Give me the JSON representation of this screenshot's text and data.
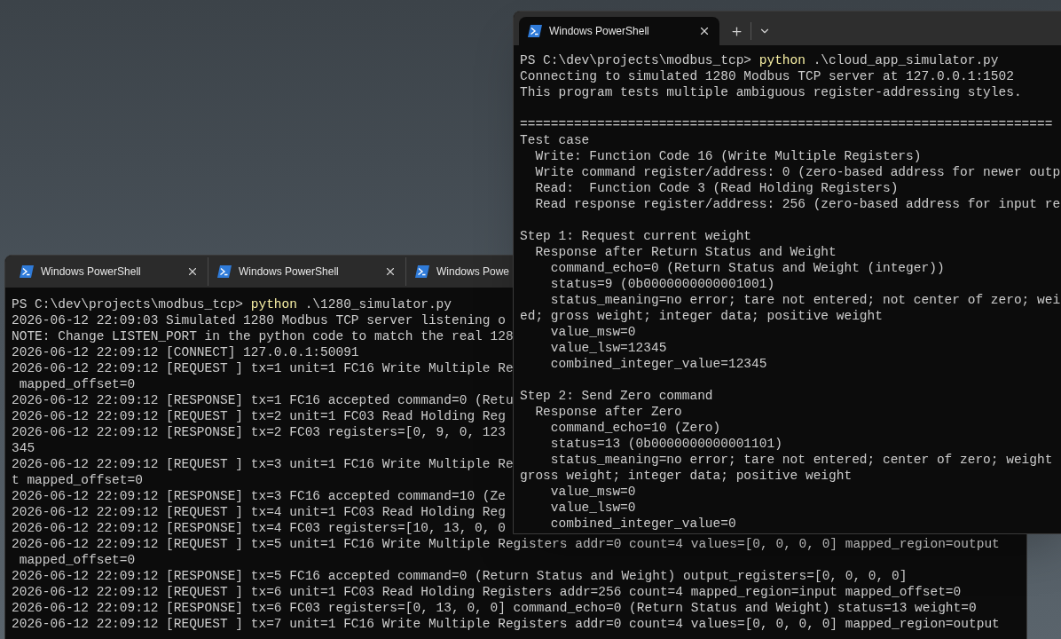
{
  "back_window": {
    "tabs": [
      {
        "title": "Windows PowerShell",
        "selected": false,
        "closable": true
      },
      {
        "title": "Windows PowerShell",
        "selected": false,
        "closable": true
      },
      {
        "title": "Windows Powe",
        "selected": false,
        "closable": false
      }
    ],
    "lines": [
      {
        "kind": "prompt",
        "prompt": "PS C:\\dev\\projects\\modbus_tcp> ",
        "command": "python",
        "args": " .\\1280_simulator.py"
      },
      {
        "kind": "output",
        "text": "2026-06-12 22:09:03 Simulated 1280 Modbus TCP server listening o"
      },
      {
        "kind": "output",
        "text": "NOTE: Change LISTEN_PORT in the python code to match the real 128"
      },
      {
        "kind": "output",
        "text": "2026-06-12 22:09:12 [CONNECT] 127.0.0.1:50091"
      },
      {
        "kind": "output",
        "text": "2026-06-12 22:09:12 [REQUEST ] tx=1 unit=1 FC16 Write Multiple Re"
      },
      {
        "kind": "output",
        "text": " mapped_offset=0"
      },
      {
        "kind": "output",
        "text": "2026-06-12 22:09:12 [RESPONSE] tx=1 FC16 accepted command=0 (Retu"
      },
      {
        "kind": "output",
        "text": "2026-06-12 22:09:12 [REQUEST ] tx=2 unit=1 FC03 Read Holding Reg"
      },
      {
        "kind": "output",
        "text": "2026-06-12 22:09:12 [RESPONSE] tx=2 FC03 registers=[0, 9, 0, 123"
      },
      {
        "kind": "output",
        "text": "345"
      },
      {
        "kind": "output",
        "text": "2026-06-12 22:09:12 [REQUEST ] tx=3 unit=1 FC16 Write Multiple Re"
      },
      {
        "kind": "output",
        "text": "t mapped_offset=0"
      },
      {
        "kind": "output",
        "text": "2026-06-12 22:09:12 [RESPONSE] tx=3 FC16 accepted command=10 (Ze"
      },
      {
        "kind": "output",
        "text": "2026-06-12 22:09:12 [REQUEST ] tx=4 unit=1 FC03 Read Holding Reg"
      },
      {
        "kind": "output",
        "text": "2026-06-12 22:09:12 [RESPONSE] tx=4 FC03 registers=[10, 13, 0, 0"
      },
      {
        "kind": "output",
        "text": "2026-06-12 22:09:12 [REQUEST ] tx=5 unit=1 FC16 Write Multiple Registers addr=0 count=4 values=[0, 0, 0, 0] mapped_region=output"
      },
      {
        "kind": "output",
        "text": " mapped_offset=0"
      },
      {
        "kind": "output",
        "text": "2026-06-12 22:09:12 [RESPONSE] tx=5 FC16 accepted command=0 (Return Status and Weight) output_registers=[0, 0, 0, 0]"
      },
      {
        "kind": "output",
        "text": "2026-06-12 22:09:12 [REQUEST ] tx=6 unit=1 FC03 Read Holding Registers addr=256 count=4 mapped_region=input mapped_offset=0"
      },
      {
        "kind": "output",
        "text": "2026-06-12 22:09:12 [RESPONSE] tx=6 FC03 registers=[0, 13, 0, 0] command_echo=0 (Return Status and Weight) status=13 weight=0"
      },
      {
        "kind": "output",
        "text": "2026-06-12 22:09:12 [REQUEST ] tx=7 unit=1 FC16 Write Multiple Registers addr=0 count=4 values=[0, 0, 0, 0] mapped_region=output"
      }
    ]
  },
  "front_window": {
    "tabs": [
      {
        "title": "Windows PowerShell",
        "selected": true,
        "closable": true
      }
    ],
    "blocks": [
      [
        {
          "kind": "prompt",
          "prompt": "PS C:\\dev\\projects\\modbus_tcp> ",
          "command": "python",
          "args": " .\\cloud_app_simulator.py"
        },
        {
          "kind": "output",
          "text": "Connecting to simulated 1280 Modbus TCP server at 127.0.0.1:1502"
        },
        {
          "kind": "output",
          "text": "This program tests multiple ambiguous register-addressing styles."
        }
      ],
      [
        {
          "kind": "output",
          "text": "====================================================================="
        },
        {
          "kind": "output",
          "text": "Test case"
        },
        {
          "kind": "output",
          "text": "  Write: Function Code 16 (Write Multiple Registers)"
        },
        {
          "kind": "output",
          "text": "  Write command register/address: 0 (zero-based address for newer outp"
        },
        {
          "kind": "output",
          "text": "  Read:  Function Code 3 (Read Holding Registers)"
        },
        {
          "kind": "output",
          "text": "  Read response register/address: 256 (zero-based address for input re"
        }
      ],
      [
        {
          "kind": "output",
          "text": "Step 1: Request current weight"
        },
        {
          "kind": "output",
          "text": "  Response after Return Status and Weight"
        },
        {
          "kind": "output",
          "text": "    command_echo=0 (Return Status and Weight (integer))"
        },
        {
          "kind": "output",
          "text": "    status=9 (0b0000000000001001)"
        },
        {
          "kind": "output",
          "text": "    status_meaning=no error; tare not entered; not center of zero; wei"
        },
        {
          "kind": "output",
          "text": "ed; gross weight; integer data; positive weight"
        },
        {
          "kind": "output",
          "text": "    value_msw=0"
        },
        {
          "kind": "output",
          "text": "    value_lsw=12345"
        },
        {
          "kind": "output",
          "text": "    combined_integer_value=12345"
        }
      ],
      [
        {
          "kind": "output",
          "text": "Step 2: Send Zero command"
        },
        {
          "kind": "output",
          "text": "  Response after Zero"
        },
        {
          "kind": "output",
          "text": "    command_echo=10 (Zero)"
        },
        {
          "kind": "output",
          "text": "    status=13 (0b0000000000001101)"
        },
        {
          "kind": "output",
          "text": "    status_meaning=no error; tare not entered; center of zero; weight"
        },
        {
          "kind": "output",
          "text": "gross weight; integer data; positive weight"
        },
        {
          "kind": "output",
          "text": "    value_msw=0"
        },
        {
          "kind": "output",
          "text": "    value_lsw=0"
        },
        {
          "kind": "output",
          "text": "    combined_integer_value=0"
        }
      ]
    ]
  }
}
